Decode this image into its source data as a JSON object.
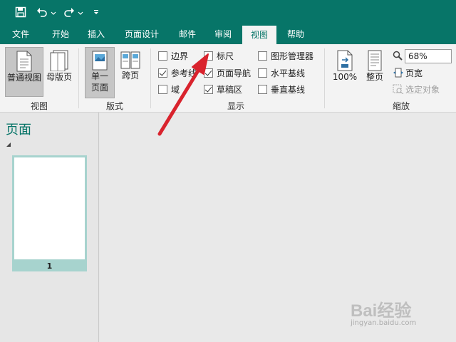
{
  "quick_access": {
    "save_icon": "save-icon",
    "undo_icon": "undo-icon",
    "redo_icon": "redo-icon",
    "customize_icon": "customize-quick-access-icon"
  },
  "tabs": [
    {
      "label": "文件"
    },
    {
      "label": "开始"
    },
    {
      "label": "插入"
    },
    {
      "label": "页面设计"
    },
    {
      "label": "邮件"
    },
    {
      "label": "审阅"
    },
    {
      "label": "视图",
      "active": true
    },
    {
      "label": "帮助"
    }
  ],
  "ribbon": {
    "view_group": {
      "label": "视图",
      "normal_view": "普通视图",
      "master_page": "母版页"
    },
    "layout_group": {
      "label": "版式",
      "single_page_line1": "单一",
      "single_page_line2": "页面",
      "two_page": "跨页"
    },
    "show_group": {
      "label": "显示",
      "checkboxes": [
        {
          "label": "边界",
          "checked": false
        },
        {
          "label": "参考线",
          "checked": true
        },
        {
          "label": "域",
          "checked": false
        },
        {
          "label": "标尺",
          "checked": false
        },
        {
          "label": "页面导航",
          "checked": true
        },
        {
          "label": "草稿区",
          "checked": true
        },
        {
          "label": "图形管理器",
          "checked": false
        },
        {
          "label": "水平基线",
          "checked": false
        },
        {
          "label": "垂直基线",
          "checked": false
        }
      ]
    },
    "zoom_group": {
      "label": "缩放",
      "hundred_percent": "100%",
      "whole_page": "整页",
      "zoom_value": "68%",
      "page_width": "页宽",
      "selected_objects": "选定对象"
    }
  },
  "left_panel": {
    "title": "页面",
    "page_number": "1"
  },
  "watermark": {
    "brand": "Bai经验",
    "url": "jingyan.baidu.com"
  },
  "colors": {
    "accent": "#077568",
    "annotation_arrow": "#d9232d"
  }
}
